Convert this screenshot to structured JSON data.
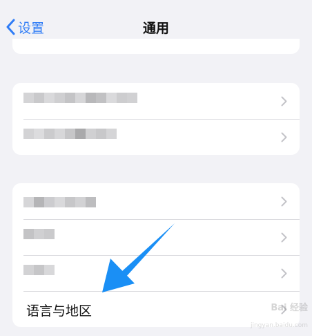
{
  "navbar": {
    "back_label": "设置",
    "title": "通用"
  },
  "list": {
    "language_region_label": "语言与地区"
  },
  "watermark": {
    "text": "Bai 经验",
    "url": "jingyan.baidu.com"
  },
  "colors": {
    "accent": "#2f7cf6",
    "background": "#f2f2f6",
    "card": "#ffffff",
    "annotation_arrow": "#1a8ff5"
  },
  "icons": {
    "back": "chevron-left-icon",
    "disclosure": "chevron-right-icon",
    "annotation": "arrow-icon"
  }
}
